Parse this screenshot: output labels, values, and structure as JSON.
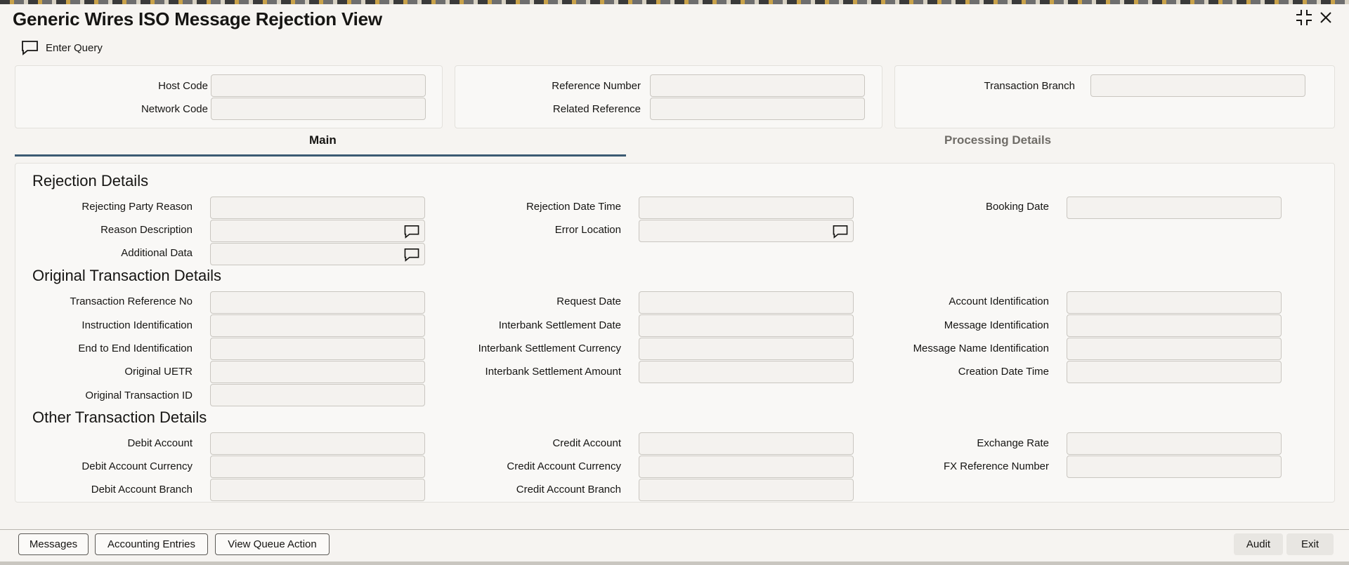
{
  "window": {
    "title": "Generic Wires ISO Message Rejection View"
  },
  "toolbar": {
    "enter_query": "Enter Query"
  },
  "header_fields": {
    "host_code": {
      "label": "Host Code",
      "value": ""
    },
    "network_code": {
      "label": "Network Code",
      "value": ""
    },
    "reference_number": {
      "label": "Reference Number",
      "value": ""
    },
    "related_reference": {
      "label": "Related Reference",
      "value": ""
    },
    "transaction_branch": {
      "label": "Transaction Branch",
      "value": ""
    }
  },
  "tabs": [
    {
      "label": "Main",
      "active": true
    },
    {
      "label": "Processing Details",
      "active": false
    }
  ],
  "sections": {
    "rejection": {
      "title": "Rejection Details",
      "rejecting_party_reason": "Rejecting Party Reason",
      "reason_description": "Reason Description",
      "additional_data": "Additional Data",
      "rejection_date_time": "Rejection Date Time",
      "error_location": "Error Location",
      "booking_date": "Booking Date"
    },
    "original": {
      "title": "Original Transaction Details",
      "transaction_reference_no": "Transaction Reference No",
      "instruction_identification": "Instruction Identification",
      "end_to_end_identification": "End to End Identification",
      "original_uetr": "Original UETR",
      "original_transaction_id": "Original Transaction ID",
      "request_date": "Request Date",
      "interbank_settlement_date": "Interbank Settlement Date",
      "interbank_settlement_currency": "Interbank Settlement Currency",
      "interbank_settlement_amount": "Interbank Settlement Amount",
      "account_identification": "Account Identification",
      "message_identification": "Message Identification",
      "message_name_identification": "Message Name Identification",
      "creation_date_time": "Creation Date Time"
    },
    "other": {
      "title": "Other Transaction Details",
      "debit_account": "Debit Account",
      "debit_account_currency": "Debit Account Currency",
      "debit_account_branch": "Debit Account Branch",
      "credit_account": "Credit Account",
      "credit_account_currency": "Credit Account Currency",
      "credit_account_branch": "Credit Account Branch",
      "exchange_rate": "Exchange Rate",
      "fx_reference_number": "FX Reference Number"
    }
  },
  "footer": {
    "messages": "Messages",
    "accounting_entries": "Accounting Entries",
    "view_queue_action": "View Queue Action",
    "audit": "Audit",
    "exit": "Exit"
  },
  "icons": {
    "maximize": "maximize-icon",
    "close": "close-icon",
    "enter_query": "chat-bubble-icon",
    "field_popup": "chat-bubble-icon"
  },
  "colors": {
    "active_tab_underline": "#3c5a73",
    "inactive_tab_text": "#6f6c67"
  }
}
